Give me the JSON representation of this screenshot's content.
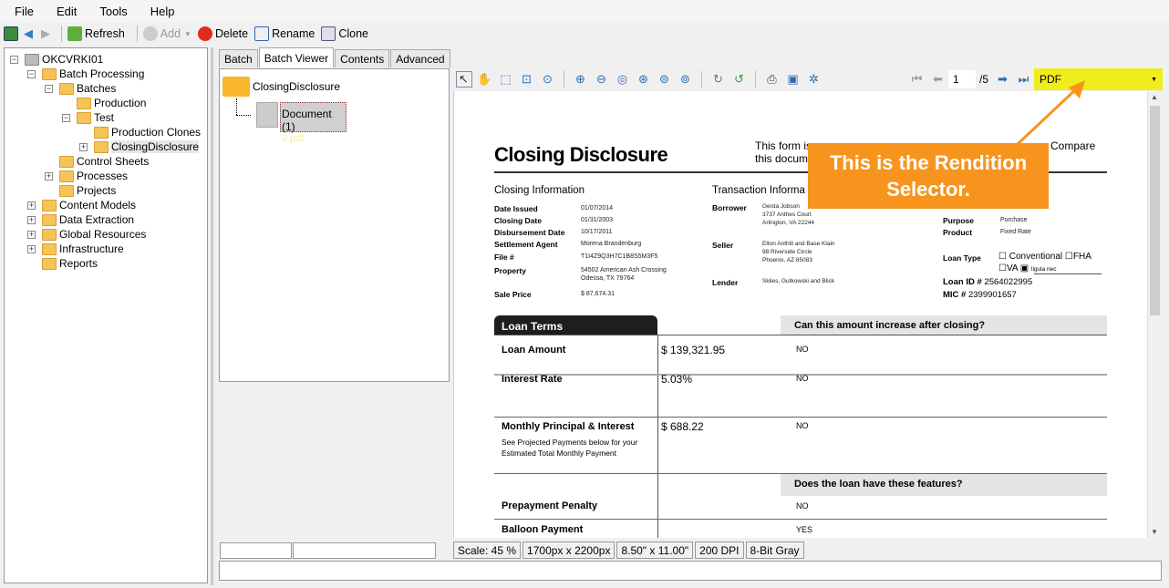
{
  "menu": [
    "File",
    "Edit",
    "Tools",
    "Help"
  ],
  "toolbar": {
    "refresh": "Refresh",
    "add": "Add",
    "delete": "Delete",
    "rename": "Rename",
    "clone": "Clone"
  },
  "tree": [
    {
      "label": "OKCVRKI01",
      "level": 0
    },
    {
      "label": "Batch Processing",
      "level": 1
    },
    {
      "label": "Batches",
      "level": 2
    },
    {
      "label": "Production",
      "level": 3
    },
    {
      "label": "Test",
      "level": 3
    },
    {
      "label": "Production Clones",
      "level": 4
    },
    {
      "label": "ClosingDisclosure",
      "level": 4,
      "selected": true
    },
    {
      "label": "Control Sheets",
      "level": 2
    },
    {
      "label": "Processes",
      "level": 2
    },
    {
      "label": "Projects",
      "level": 2
    },
    {
      "label": "Content Models",
      "level": 1
    },
    {
      "label": "Data Extraction",
      "level": 1
    },
    {
      "label": "Global Resources",
      "level": 1
    },
    {
      "label": "Infrastructure",
      "level": 1
    },
    {
      "label": "Reports",
      "level": 1
    }
  ],
  "tabs": [
    "Batch",
    "Batch Viewer",
    "Contents",
    "Advanced"
  ],
  "active_tab": "Batch Viewer",
  "batch_viewer": {
    "folder": "ClosingDisclosure",
    "doc_name": "Document (1)",
    "doc_file": "0.pdf"
  },
  "viewer": {
    "page": "1",
    "page_total": "/5",
    "rendition": "PDF",
    "rendition_color": "#f0ed1c"
  },
  "document": {
    "title": "Closing Disclosure",
    "intro": [
      "This form is",
      "Compare",
      "this docum"
    ],
    "closing_info_title": "Closing  Information",
    "closing_info": [
      {
        "label": "Date Issued",
        "value": "01/07/2014"
      },
      {
        "label": "Closing Date",
        "value": "01/31/2003"
      },
      {
        "label": "Disbursement Date",
        "value": "10/17/2011"
      },
      {
        "label": "Settlement Agent",
        "value": "Morena Brandenburg"
      },
      {
        "label": "File #",
        "value": "T1I4Z9Q3H7C1B8S5M3F5"
      },
      {
        "label": "Property",
        "value": "54502 American Ash Crossing",
        "value2": "Odessa, TX 79764"
      },
      {
        "label": "Sale Price",
        "value": "$ 87,674.31"
      }
    ],
    "transaction_title": "Transaction  Informa",
    "transaction": [
      {
        "label": "Borrower",
        "lines": [
          "Gerda Jobson",
          "3737 Anthes Court",
          "Arlington, VA 22244"
        ]
      },
      {
        "label": "Seller",
        "lines": [
          "Elton Anthill and Base Klain",
          "98 Riverside Circle",
          "Phoenix, AZ 85083"
        ]
      },
      {
        "label": "Lender",
        "lines": [
          "Skiles, Gutkowski and Blick"
        ]
      }
    ],
    "loan_info": [
      {
        "label": "Purpose",
        "value": "Purchase"
      },
      {
        "label": "Product",
        "value": "Fixed Rate"
      }
    ],
    "loan_type_label": "Loan Type",
    "loan_types": [
      "Conventional",
      "FHA",
      "VA",
      "ligula nec"
    ],
    "loan_id": {
      "label": "Loan ID #",
      "value": "2564022995"
    },
    "mic": {
      "label": "MIC #",
      "value": "2399901657"
    },
    "loan_terms_title": "Loan Terms",
    "increase_q": "Can this amount increase after closing?",
    "terms": [
      {
        "label": "Loan Amount",
        "value": "$ 139,321.95",
        "answer": "NO"
      },
      {
        "label": "Interest Rate",
        "value": "5.03%",
        "answer": "NO"
      },
      {
        "label": "Monthly Principal & Interest",
        "sub1": "See Projected Payments below for your",
        "sub2": "Estimated Total Monthly Payment",
        "value": "$ 688.22",
        "answer": "NO"
      }
    ],
    "features_q": "Does the loan have these features?",
    "features": [
      {
        "label": "Prepayment Penalty",
        "answer": "NO"
      },
      {
        "label": "Balloon Payment",
        "answer": "YES"
      }
    ]
  },
  "status": [
    "Scale: 45 %",
    "1700px x 2200px",
    "8.50\" x 11.00\"",
    "200 DPI",
    "8-Bit Gray"
  ],
  "callout": {
    "line1": "This is the Rendition",
    "line2": "Selector.",
    "color": "#f7941d"
  }
}
